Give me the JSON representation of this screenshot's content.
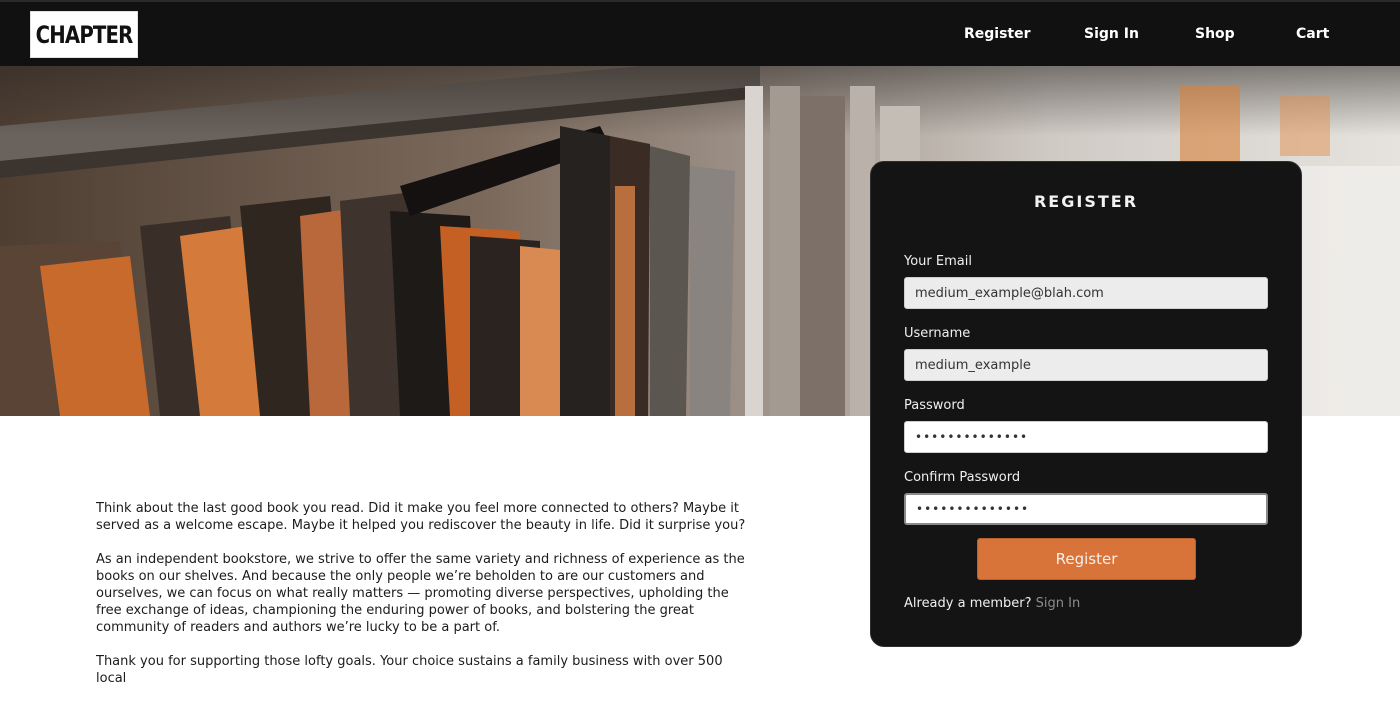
{
  "nav": {
    "logo": "CHAPTER",
    "links": [
      "Register",
      "Sign In",
      "Shop",
      "Cart"
    ]
  },
  "intro": {
    "paragraphs": [
      "Think about the last good book you read. Did it make you feel more connected to others? Maybe it served as a welcome escape. Maybe it helped you rediscover the beauty in life. Did it surprise you?",
      "As an independent bookstore, we strive to offer the same variety and richness of experience as the books on our shelves. And because the only people we’re beholden to are our customers and ourselves, we can focus on what really matters — promoting diverse perspectives, upholding the free exchange of ideas, championing the enduring power of books, and bolstering the great community of readers and authors we’re lucky to be a part of.",
      "Thank you for supporting those lofty goals. Your choice sustains a family business with over 500 local"
    ]
  },
  "register": {
    "title": "REGISTER",
    "email_label": "Your Email",
    "email_value": "medium_example@blah.com",
    "username_label": "Username",
    "username_value": "medium_example",
    "password_label": "Password",
    "password_value": "••••••••••••••",
    "confirm_label": "Confirm Password",
    "confirm_value": "••••••••••••••",
    "button_label": "Register",
    "member_prompt": "Already a member?",
    "signin_link": "Sign In"
  },
  "colors": {
    "nav_bg": "#111111",
    "card_bg": "#141414",
    "accent": "#d8733a"
  }
}
